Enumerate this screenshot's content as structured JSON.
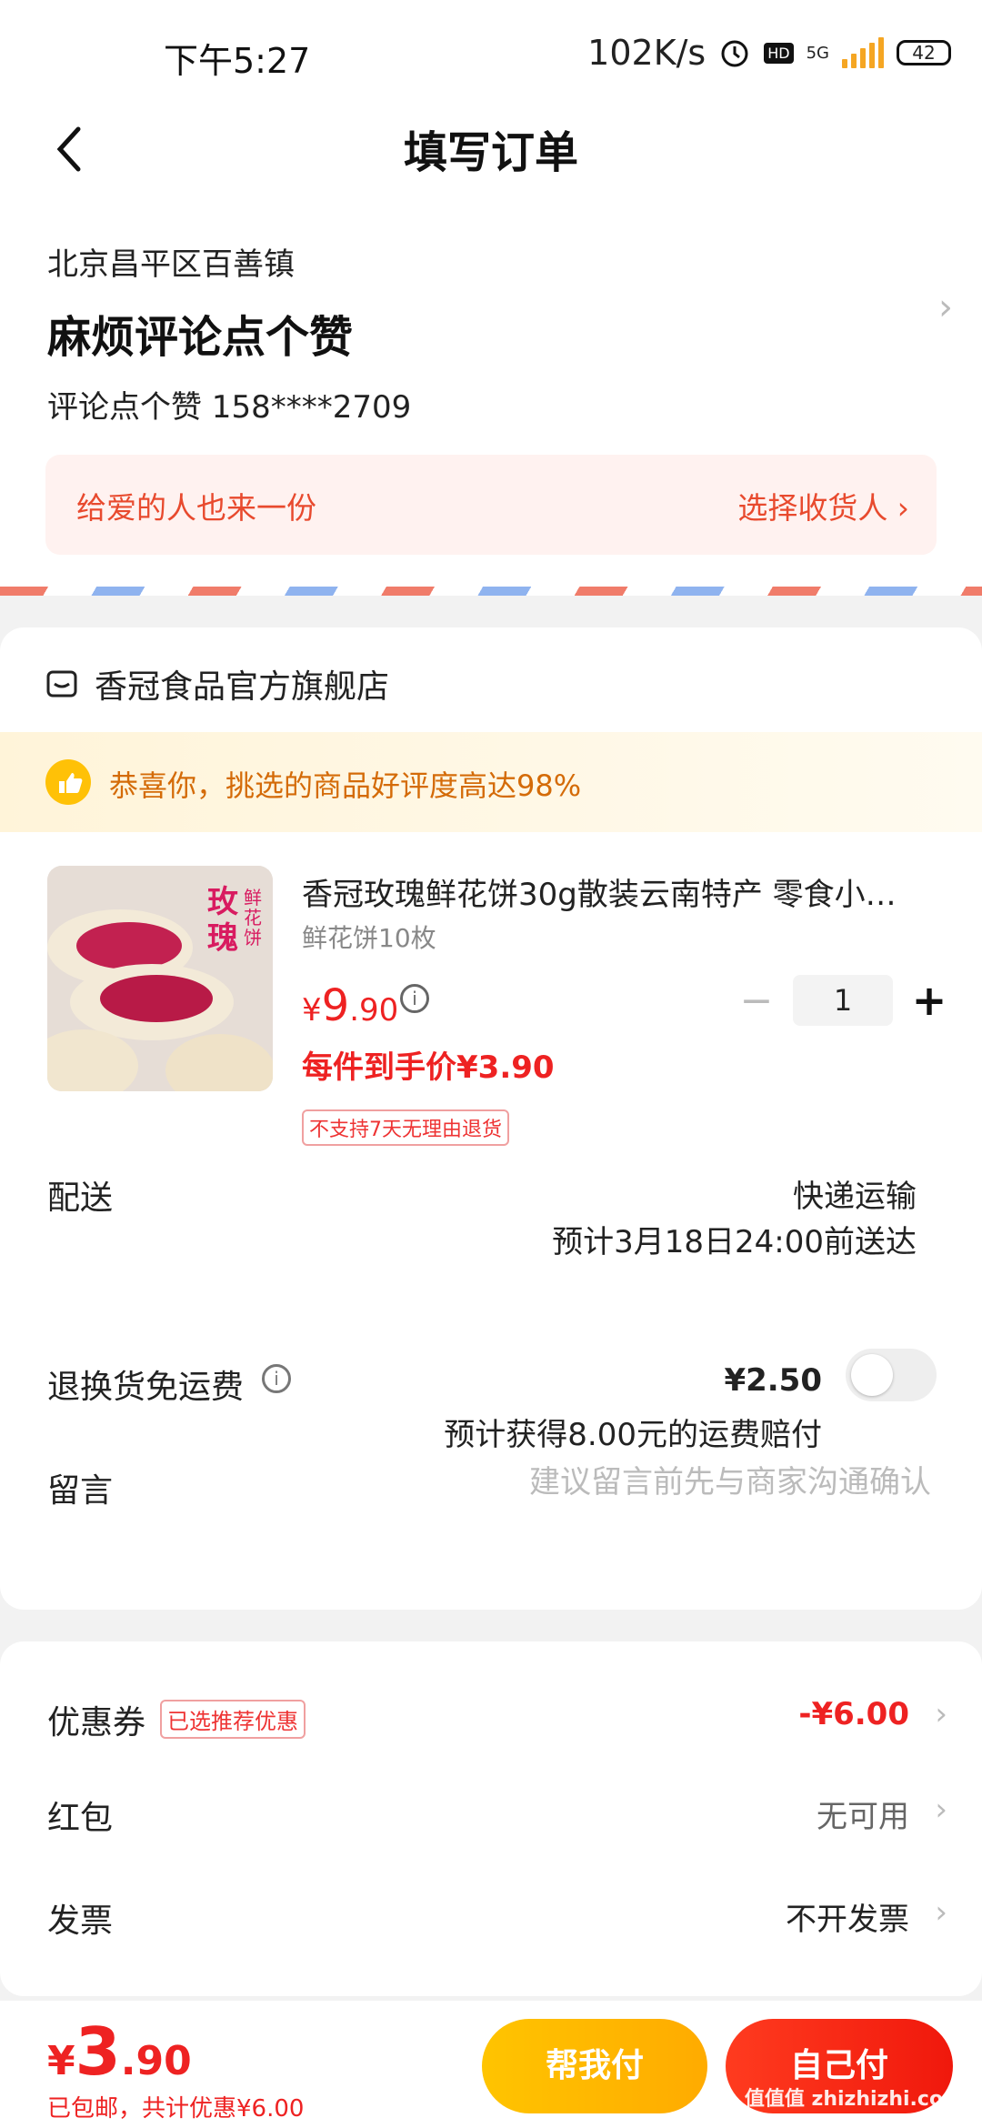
{
  "status_bar": {
    "time": "下午5:27",
    "speed": "102K/s",
    "net": "5G",
    "battery": "42"
  },
  "header": {
    "title": "填写订单"
  },
  "address": {
    "region": "北京昌平区百善镇",
    "detail": "麻烦评论点个赞",
    "contact": "评论点个赞  158****2709",
    "gift_text": "给爱的人也来一份",
    "gift_action": "选择收货人 ›"
  },
  "shop": {
    "name": "香冠食品官方旗舰店",
    "banner": "恭喜你，挑选的商品好评度高达98%",
    "product": {
      "name": "香冠玫瑰鲜花饼30g散装云南特产  零食小…",
      "spec": "鲜花饼10枚",
      "price_currency": "¥",
      "price_int": "9",
      "price_dec": ".90",
      "quantity": "1",
      "per_price": "每件到手价¥3.90",
      "tag": "不支持7天无理由退货",
      "image_text_1": "玫瑰",
      "image_text_2": "鲜花饼"
    },
    "delivery": {
      "label": "配送",
      "method": "快递运输",
      "eta": "预计3月18日24:00前送达"
    },
    "return": {
      "label": "退换货免运费",
      "price": "¥2.50",
      "note": "预计获得8.00元的运费赔付"
    },
    "message": {
      "label": "留言",
      "placeholder": "建议留言前先与商家沟通确认"
    }
  },
  "discounts": {
    "coupon": {
      "label": "优惠券",
      "tag": "已选推荐优惠",
      "value": "-¥6.00"
    },
    "redpacket": {
      "label": "红包",
      "value": "无可用"
    },
    "invoice": {
      "label": "发票",
      "value": "不开发票"
    }
  },
  "bottom": {
    "currency": "¥",
    "total_int": "3",
    "total_dec": ".90",
    "sub": "已包邮，共计优惠¥6.00",
    "help_pay": "帮我付",
    "self_pay": "自己付",
    "watermark": "值值值 zhizhizhi.com"
  },
  "colors": {
    "accent": "#e22222",
    "yellow": "#ffb300",
    "banner_text": "#d46b08"
  }
}
